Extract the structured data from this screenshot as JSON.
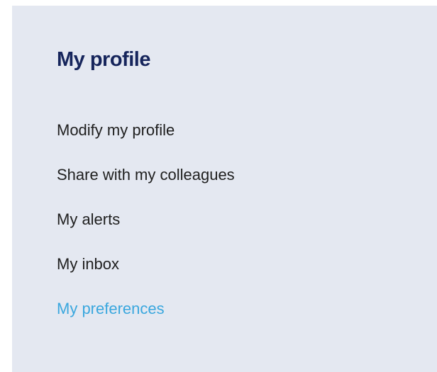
{
  "profile_menu": {
    "title": "My profile",
    "items": [
      {
        "label": "Modify my profile"
      },
      {
        "label": "Share with my colleagues"
      },
      {
        "label": "My alerts"
      },
      {
        "label": "My inbox"
      },
      {
        "label": "My preferences"
      }
    ],
    "colors": {
      "background": "#e4e8f1",
      "title": "#16255c",
      "item": "#1f1f1f",
      "active_item": "#3aa7de"
    }
  }
}
